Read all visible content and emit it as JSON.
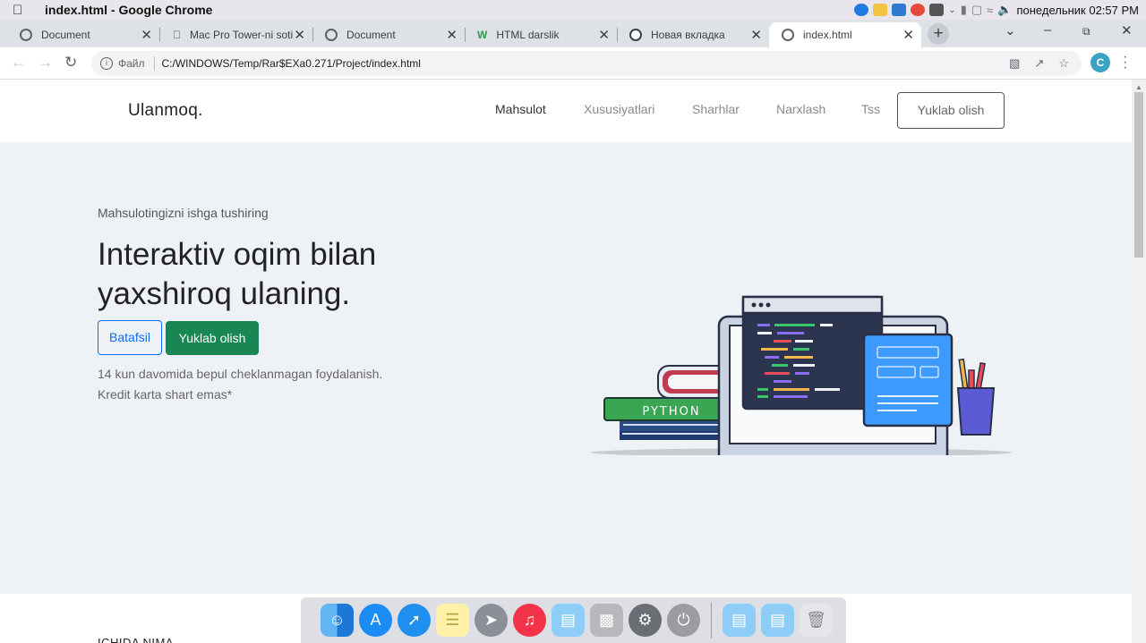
{
  "os_menubar": {
    "app_title": "index.html - Google Chrome",
    "clock": "понедельник 02:57 PM"
  },
  "browser": {
    "tabs": [
      {
        "label": "Document",
        "icon": "globe-icon"
      },
      {
        "label": "Mac Pro Tower-ni soti",
        "icon": "apple-icon"
      },
      {
        "label": "Document",
        "icon": "globe-icon"
      },
      {
        "label": "HTML darslik",
        "icon": "w-logo-icon"
      },
      {
        "label": "Новая вкладка",
        "icon": "chrome-icon"
      },
      {
        "label": "index.html",
        "icon": "globe-icon",
        "active": true
      }
    ],
    "address": {
      "scheme_label": "Файл",
      "url": "C:/WINDOWS/Temp/Rar$EXa0.271/Project/index.html"
    },
    "profile_initial": "C"
  },
  "site": {
    "logo": "Ulanmoq.",
    "nav": [
      "Mahsulot",
      "Xususiyatlari",
      "Sharhlar",
      "Narxlash",
      "Tss"
    ],
    "nav_cta": "Yuklab olish",
    "hero": {
      "kicker": "Mahsulotingizni ishga tushiring",
      "headline_line1": "Interaktiv oqim bilan",
      "headline_line2": "yaxshiroq ulaning.",
      "btn_secondary": "Batafsil",
      "btn_primary": "Yuklab olish",
      "note_line1": "14 kun davomida bepul cheklanmagan foydalanish.",
      "note_line2": "Kredit karta shart emas*",
      "illustration_book_label": "PYTHON"
    },
    "next_section_title": "ICHIDA NIMA"
  },
  "colors": {
    "primary": "#0d6efd",
    "success": "#198754",
    "hero_bg": "#eef2f7"
  },
  "dock": [
    "finder-icon",
    "app-store-icon",
    "safari-icon",
    "notes-icon",
    "launchpad-icon",
    "music-icon",
    "folder-icon",
    "mac-pro-icon",
    "system-preferences-icon",
    "shutdown-icon",
    "downloads-folder-icon",
    "documents-folder-icon",
    "trash-icon"
  ]
}
